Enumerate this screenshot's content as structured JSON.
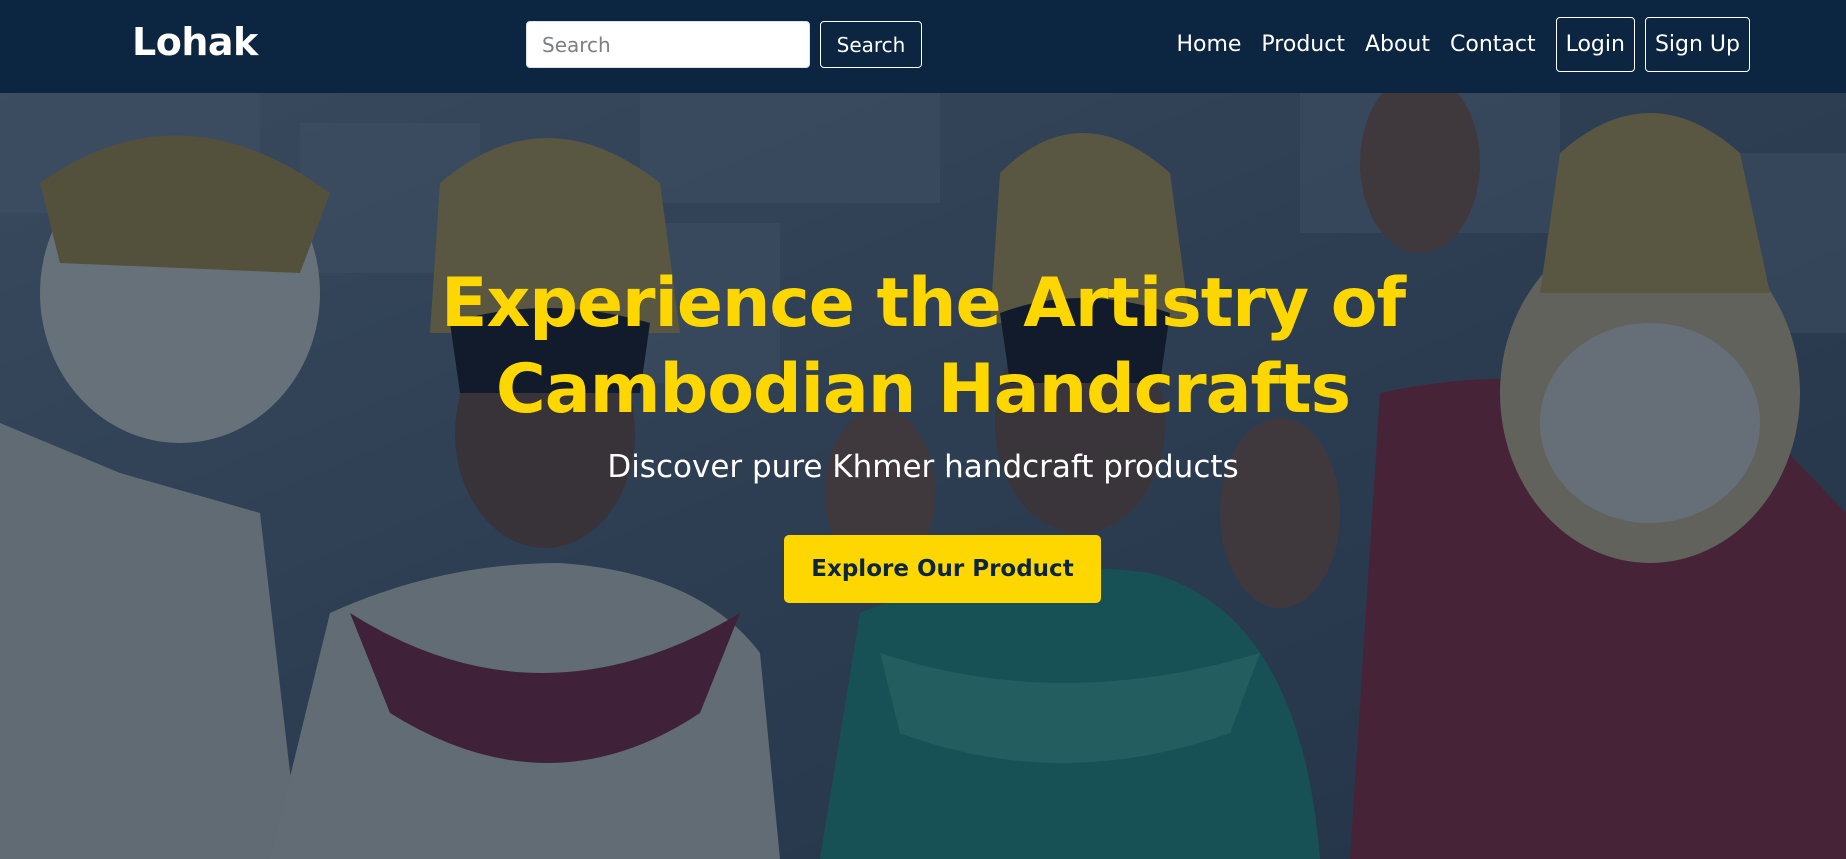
{
  "navbar": {
    "brand": "Lohak",
    "search": {
      "placeholder": "Search",
      "value": "",
      "button_label": "Search"
    },
    "links": [
      "Home",
      "Product",
      "About",
      "Contact"
    ],
    "login_label": "Login",
    "signup_label": "Sign Up"
  },
  "hero": {
    "title": "Experience the Artistry of Cambodian Handcrafts",
    "subtitle": "Discover pure Khmer handcraft products",
    "cta_label": "Explore Our Product"
  },
  "colors": {
    "navbar_bg": "#0c2540",
    "accent": "#ffd700",
    "text": "#ffffff"
  }
}
